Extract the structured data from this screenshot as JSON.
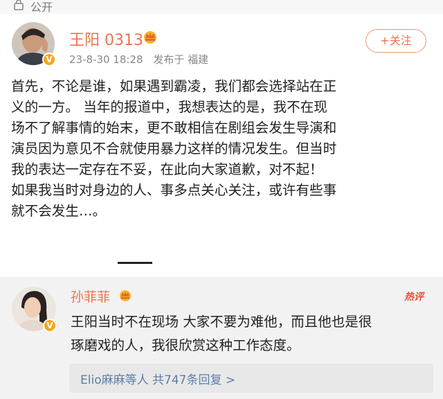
{
  "header": {
    "visibility": "公开",
    "lock_icon": "lock-icon"
  },
  "post": {
    "author": "王阳 0313",
    "verified_badge": "V",
    "date": "23-8-30 18:28",
    "source": "发布于 福建",
    "follow_label": "+关注",
    "content_lines": [
      "首先，不论是谁，如果遇到霸凌，我们都会选择站在正",
      "义的一方。  当年的报道中，我想表达的是，我不在现",
      "场不了解事情的始末，更不敢相信在剧组会发生导演和",
      "演员因为意见不合就使用暴力这样的情况发生。但当时",
      "我的表达一定存在不妥，在此向大家道歉，对不起！",
      "  如果我当时对身边的人、事多点关心关注，或许有些事",
      "就不会发生…。"
    ]
  },
  "comment": {
    "author": "孙菲菲",
    "verified_badge": "V",
    "hot_label": "热评",
    "lines": [
      "王阳当时不在现场 大家不要为难他，而且他也是很",
      "琢磨戏的人，我很欣赏这种工作态度。"
    ],
    "reply_summary": "Elio麻麻等人  共747条回复 >"
  },
  "colors": {
    "accent": "#eb7350",
    "link": "#5d7fa8",
    "badge": "#f7a51c"
  }
}
